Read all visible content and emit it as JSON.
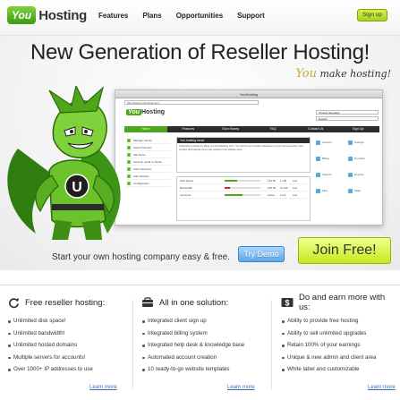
{
  "brand": {
    "you": "You",
    "hosting": "Hosting"
  },
  "nav": [
    "Features",
    "Plans",
    "Opportunities",
    "Support"
  ],
  "signup_label": "Sign up",
  "hero": {
    "title": "New Generation of Reseller Hosting!",
    "tagline_you": "You",
    "tagline_rest": " make hosting!"
  },
  "mock": {
    "window_title": "YouHosting",
    "url": "http://www.youhosting.com",
    "logo_you": "You",
    "logo_hosting": "Hosting",
    "tabs": [
      "Home",
      "Features",
      "Earn Money",
      "FAQ",
      "Contact Us",
      "Sign Up"
    ],
    "sidebar": [
      "Manage Clients",
      "Search Domain",
      "Site News",
      "Send an email to clients",
      "Client Services",
      "Administrator",
      "Configuration"
    ],
    "news_heading": "You hosting news",
    "news_text": "Subscribe to News by filling out the following form. You will be sent email notifications of your Account when new product and special prices are posted in the Affiliate area.",
    "rows": [
      {
        "name": "Disk Space",
        "fill": 0.35,
        "a": "134.50",
        "b": "1 GB",
        "c": "Left"
      },
      {
        "name": "Bandwidth",
        "fill": 0.15,
        "a": "150.00",
        "b": "10 GB",
        "c": "Left"
      },
      {
        "name": "Accounts",
        "fill": 0.5,
        "a": "Active",
        "b": "Limit",
        "c": "Left"
      }
    ],
    "select_1": "Choose language",
    "select_2": "English",
    "grid": [
      "Account",
      "Settings",
      "Billing",
      "Domains",
      "Support",
      "Reports",
      "Files",
      "Stats"
    ]
  },
  "cta": {
    "text": "Start your own hosting company easy & free.",
    "demo": "Try Demo",
    "join": "Join Free!"
  },
  "columns": [
    {
      "title": "Free reseller hosting:",
      "icon": "refresh-icon",
      "items": [
        "Unlimited disk space!",
        "Unlimited bandwidth!",
        "Unlimited hosted domains",
        "Multiple servers for accounts!",
        "Over 1000+ IP addresses to use"
      ],
      "more": "Learn more"
    },
    {
      "title": "All in one solution:",
      "icon": "box-icon",
      "items": [
        "Integrated client sign up",
        "Integrated billing system",
        "Integrated help desk & knowledge base",
        "Automated account creation",
        "10 ready-to-go website templates"
      ],
      "more": "Learn more"
    },
    {
      "title": "Do and earn more with us:",
      "icon": "money-icon",
      "items": [
        "Ability to provide free hosting",
        "Ability to sell unlimited upgrades",
        "Retain 100% of your earnings",
        "Unique & new admin and client area",
        "White label and customizable"
      ],
      "more": "Learn more"
    }
  ]
}
